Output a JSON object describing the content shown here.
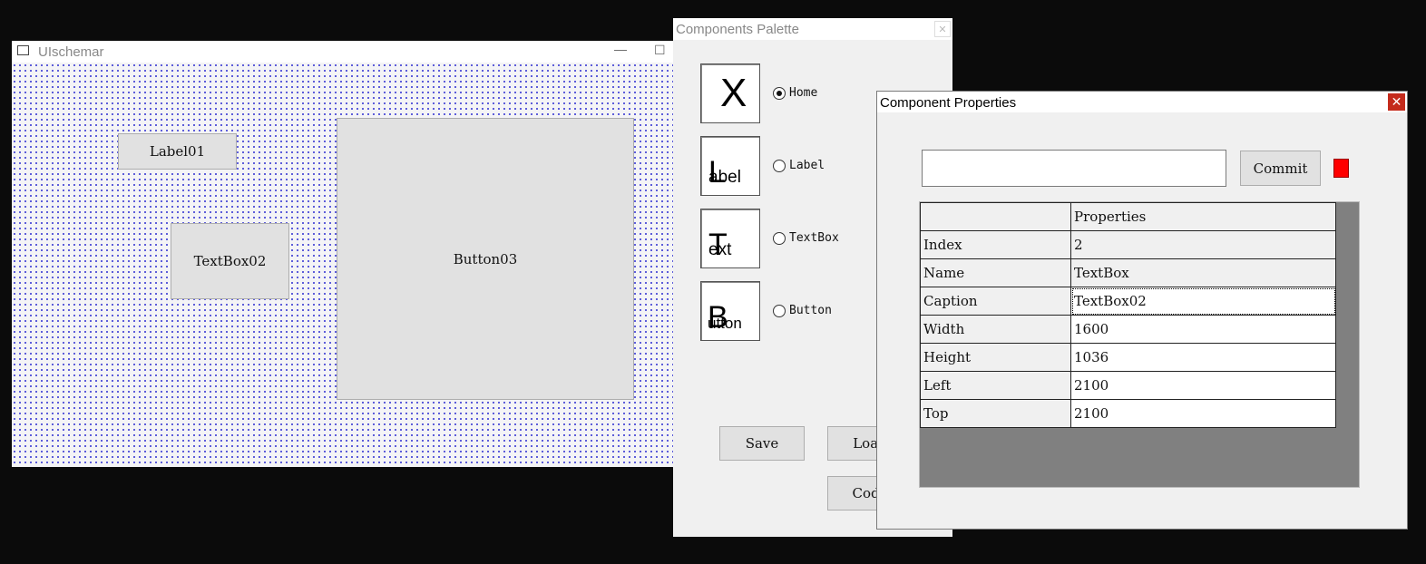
{
  "schemar": {
    "title": "UIschemar",
    "minimize": "—",
    "maximize": "☐",
    "controls": {
      "label": "Label01",
      "textbox": "TextBox02",
      "button": "Button03"
    }
  },
  "palette": {
    "title": "Components Palette",
    "close": "✕",
    "tiles": [
      {
        "big": "X",
        "small": ""
      },
      {
        "big": "L",
        "small": "abel"
      },
      {
        "big": "T",
        "small": "ext"
      },
      {
        "big": "B",
        "small": "utton"
      }
    ],
    "radios": [
      {
        "label": "Home",
        "selected": true
      },
      {
        "label": "Label",
        "selected": false
      },
      {
        "label": "TextBox",
        "selected": false
      },
      {
        "label": "Button",
        "selected": false
      }
    ],
    "buttons": {
      "save": "Save",
      "load": "Load",
      "code": "Code"
    }
  },
  "properties": {
    "title": "Component Properties",
    "close": "✕",
    "input_value": "",
    "commit": "Commit",
    "indicator_color": "#ff0000",
    "header": {
      "key": "",
      "value": "Properties"
    },
    "rows": [
      {
        "key": "Index",
        "value": "2"
      },
      {
        "key": "Name",
        "value": "TextBox"
      },
      {
        "key": "Caption",
        "value": "TextBox02"
      },
      {
        "key": "Width",
        "value": "1600"
      },
      {
        "key": "Height",
        "value": "1036"
      },
      {
        "key": "Left",
        "value": "2100"
      },
      {
        "key": "Top",
        "value": "2100"
      }
    ]
  }
}
